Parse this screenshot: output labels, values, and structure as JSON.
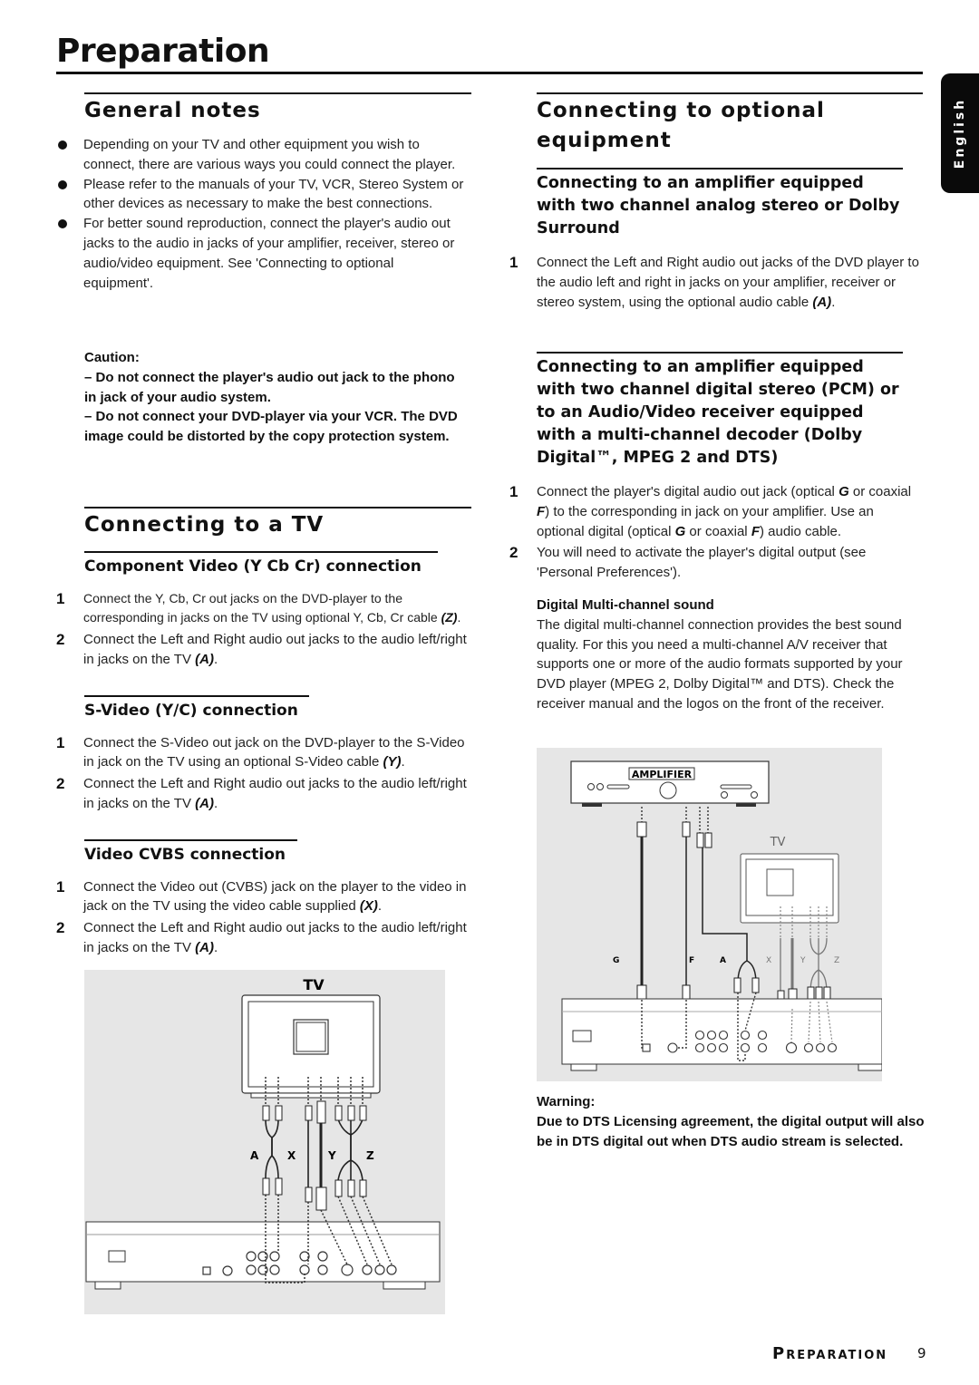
{
  "page": {
    "title": "Preparation",
    "language_tab": "English",
    "footer_section": "Preparation",
    "footer_page_number": "9"
  },
  "general_notes": {
    "heading": "General notes",
    "bullets": [
      "Depending on your TV and other equipment you wish to connect, there are various ways you could connect the player.",
      "Please refer to the manuals of your TV, VCR, Stereo System or other devices as necessary to make the best connections.",
      "For better sound reproduction, connect the player's audio out jacks to the audio in jacks of your amplifier, receiver, stereo or audio/video equipment. See 'Connecting to optional equipment'."
    ],
    "caution": {
      "label": "Caution:",
      "items": [
        "–  Do not connect  the player's audio out jack to the phono in jack of your audio system.",
        "–  Do not connect your DVD-player via your VCR. The DVD image could be distorted by the copy protection system."
      ]
    }
  },
  "connecting_tv": {
    "heading": "Connecting to a TV",
    "sections": [
      {
        "heading": "Component Video (Y Cb Cr) connection",
        "steps": [
          {
            "n": "1",
            "text": "Connect the Y, Cb, Cr out jacks on the DVD-player to the corresponding in jacks on the TV using optional Y, Cb, Cr cable ",
            "label": "(Z)",
            "end": "."
          },
          {
            "n": "2",
            "text": "Connect the Left and Right audio out jacks to the audio left/right in jacks on the TV ",
            "label": "(A)",
            "end": "."
          }
        ]
      },
      {
        "heading": "S-Video (Y/C) connection",
        "steps": [
          {
            "n": "1",
            "text": "Connect the S-Video out jack on the DVD-player to the S-Video in jack on the TV using an optional S-Video cable ",
            "label": "(Y)",
            "end": "."
          },
          {
            "n": "2",
            "text": "Connect the Left and Right audio out jacks to the audio left/right in jacks on the TV ",
            "label": "(A)",
            "end": "."
          }
        ]
      },
      {
        "heading": "Video CVBS connection",
        "steps": [
          {
            "n": "1",
            "text": "Connect the Video out (CVBS) jack on the player to the video in jack on the TV using the video cable supplied ",
            "label": "(X)",
            "end": "."
          },
          {
            "n": "2",
            "text": "Connect the Left and Right audio out jacks to the audio left/right in jacks on the TV ",
            "label": "(A)",
            "end": "."
          }
        ]
      }
    ],
    "diagram": {
      "device_label": "TV",
      "cable_labels": [
        "A",
        "X",
        "Y",
        "Z"
      ]
    }
  },
  "optional_equipment": {
    "heading": "Connecting to optional equipment",
    "analog": {
      "heading": "Connecting to an amplifier equipped with two channel analog stereo or Dolby Surround",
      "steps": [
        {
          "n": "1",
          "text": "Connect the Left and Right audio out jacks of the DVD player to the audio left and right in jacks on your amplifier, receiver or stereo system,  using the optional audio cable ",
          "label": "(A)",
          "end": "."
        }
      ]
    },
    "digital": {
      "heading": "Connecting to an amplifier equipped with two channel digital stereo (PCM) or to an Audio/Video receiver equipped with a multi-channel decoder (Dolby Digital™, MPEG 2 and DTS)",
      "steps": [
        {
          "n": "1",
          "parts": [
            "Connect the player's digital audio out jack (optical ",
            "G",
            " or coaxial ",
            "F",
            ") to the corresponding in jack on your amplifier. Use an optional digital (optical ",
            "G",
            " or coaxial ",
            "F",
            ") audio cable."
          ]
        },
        {
          "n": "2",
          "text": "You will need to activate the player's digital output (see 'Personal Preferences')."
        }
      ]
    },
    "multichannel": {
      "heading": "Digital Multi-channel sound",
      "text": "The digital multi-channel connection provides the best sound quality. For this you need a multi-channel A/V receiver that supports one or more of the audio formats supported by your DVD player (MPEG 2, Dolby Digital™ and DTS). Check the receiver manual and the logos on the front of the receiver."
    },
    "diagram": {
      "amplifier_label": "AMPLIFIER",
      "tv_label": "TV",
      "cable_labels": [
        "G",
        "F",
        "A",
        "X",
        "Y",
        "Z"
      ]
    },
    "warning": {
      "label": "Warning:",
      "text": "Due to DTS Licensing agreement, the digital output will also be in DTS digital out when DTS audio stream is selected."
    }
  }
}
